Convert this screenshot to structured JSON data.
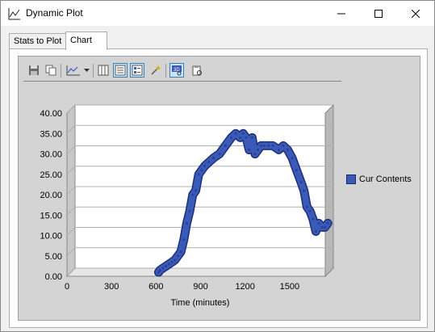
{
  "window": {
    "title": "Dynamic Plot"
  },
  "tabs": [
    {
      "label": "Stats to Plot",
      "active": false
    },
    {
      "label": "Chart",
      "active": true
    }
  ],
  "toolbar": {
    "icons": [
      "save-icon",
      "copy-icon",
      "chart-type-icon",
      "chart-type-dropdown-icon",
      "data-grid-icon",
      "legend-box-icon",
      "properties-icon",
      "wizard-icon",
      "3d-view-icon",
      "clipboard-export-icon"
    ]
  },
  "chart_data": {
    "type": "line",
    "xlabel": "Time (minutes)",
    "ylabel": "",
    "xlim": [
      0,
      1740
    ],
    "ylim": [
      0,
      40
    ],
    "x_ticks": [
      "0",
      "300",
      "600",
      "900",
      "1200",
      "1500"
    ],
    "y_ticks": [
      "0.00",
      "5.00",
      "10.00",
      "15.00",
      "20.00",
      "25.00",
      "30.00",
      "35.00",
      "40.00"
    ],
    "grid": true,
    "legend_position": "right",
    "series": [
      {
        "name": "Cur Contents",
        "color": "#3a5ab8",
        "x": [
          590,
          600,
          620,
          640,
          660,
          680,
          700,
          720,
          740,
          760,
          780,
          800,
          820,
          840,
          860,
          880,
          900,
          930,
          960,
          1000,
          1040,
          1080,
          1110,
          1140,
          1160,
          1180,
          1200,
          1220,
          1240,
          1260,
          1280,
          1300,
          1330,
          1360,
          1400,
          1430,
          1460,
          1490,
          1520,
          1550,
          1570,
          1590,
          1610,
          1630,
          1650,
          1670,
          1690,
          1710,
          1730
        ],
        "values": [
          0,
          0.5,
          1,
          1.5,
          2,
          2.5,
          3,
          4,
          5,
          8,
          12,
          15,
          19,
          20,
          24,
          25,
          26,
          27,
          28,
          29,
          31,
          33,
          34,
          33,
          34,
          33,
          30,
          33,
          29,
          30,
          31,
          31,
          31,
          31,
          30,
          31,
          30,
          28,
          25,
          22,
          20,
          16,
          15,
          13,
          10,
          12,
          11,
          11,
          12
        ]
      }
    ]
  }
}
